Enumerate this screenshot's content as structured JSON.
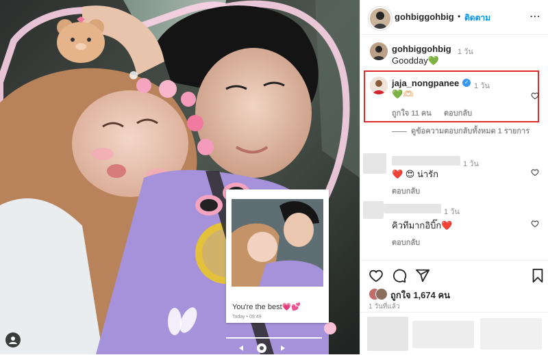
{
  "post": {
    "photo": {
      "polaroid_caption": "You're the best💗💕",
      "polaroid_time": "Today • 09:49"
    }
  },
  "header": {
    "username": "gohbiggohbig",
    "separator": "•",
    "follow_label": "ติดตาม"
  },
  "caption": {
    "username": "gohbiggohbig",
    "time": "1 วัน",
    "text": "Goodday💚"
  },
  "comments": [
    {
      "username": "jaja_nongpanee",
      "verified": true,
      "time": "1 วัน",
      "text": "💚🫶🏻",
      "likes": "ถูกใจ 11 คน",
      "reply": "ตอบกลับ"
    },
    {
      "view_replies": "ดูข้อความตอบกลับทั้งหมด 1 รายการ"
    },
    {
      "time": "1 วัน",
      "text": "❤️ 😍 น่ารัก",
      "reply": "ตอบกลับ"
    },
    {
      "time": "1 วัน",
      "text": "คิวทีมากอิบิ๊ก❤️",
      "reply": "ตอบกลับ"
    }
  ],
  "footer": {
    "likes": "ถูกใจ 1,674 คน",
    "posted": "1 วันที่แล้ว"
  },
  "colors": {
    "link": "#0095f6",
    "highlight_border": "#e0282a",
    "verified": "#3897f0"
  }
}
